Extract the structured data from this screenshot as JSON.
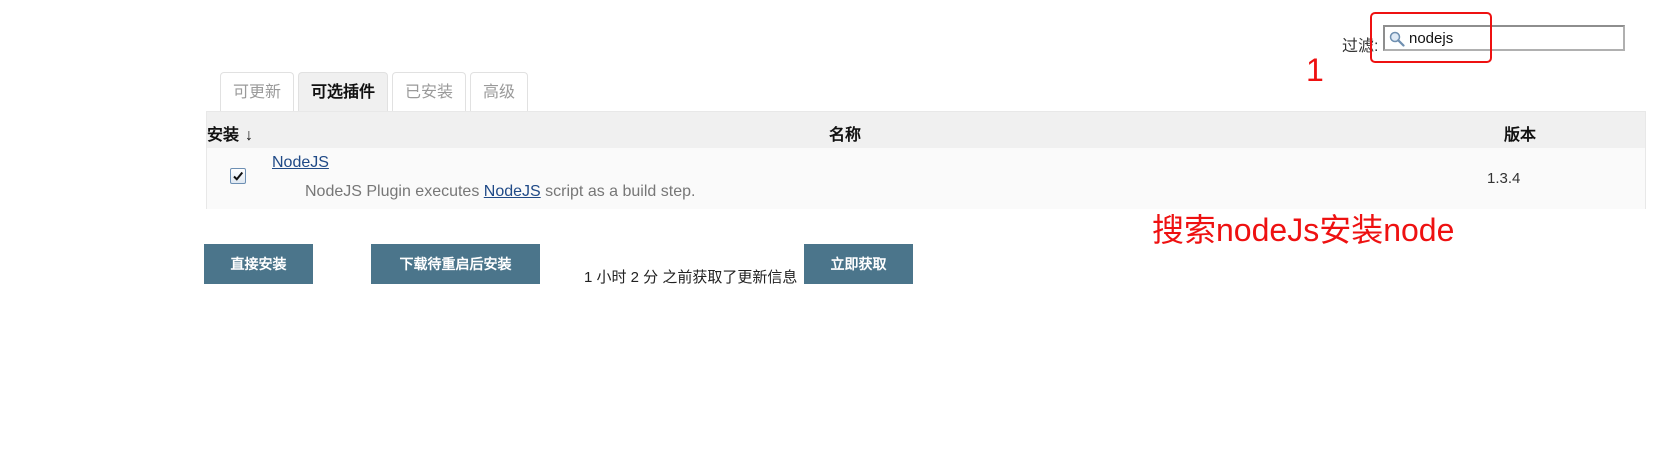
{
  "filter": {
    "label": "过滤:",
    "value": "nodejs"
  },
  "annotations": {
    "number": "1",
    "note": "搜索nodeJs安装node",
    "color": "#ee1111"
  },
  "tabs": [
    {
      "label": "可更新",
      "active": false
    },
    {
      "label": "可选插件",
      "active": true
    },
    {
      "label": "已安装",
      "active": false
    },
    {
      "label": "高级",
      "active": false
    }
  ],
  "table": {
    "headers": {
      "install": "安装",
      "sort_indicator": "↓",
      "name": "名称",
      "version": "版本"
    },
    "rows": [
      {
        "checked": true,
        "name": "NodeJS",
        "desc_prefix": "NodeJS Plugin executes ",
        "desc_link": "NodeJS",
        "desc_suffix": " script as a build step.",
        "version": "1.3.4"
      }
    ]
  },
  "actions": {
    "install_now": "直接安装",
    "download_restart": "下载待重启后安装",
    "updated_info": "1 小时 2 分 之前获取了更新信息",
    "fetch_now": "立即获取"
  },
  "colors": {
    "button_bg": "#4b758b",
    "link": "#204a87",
    "header_bg": "#f0f0f0"
  }
}
